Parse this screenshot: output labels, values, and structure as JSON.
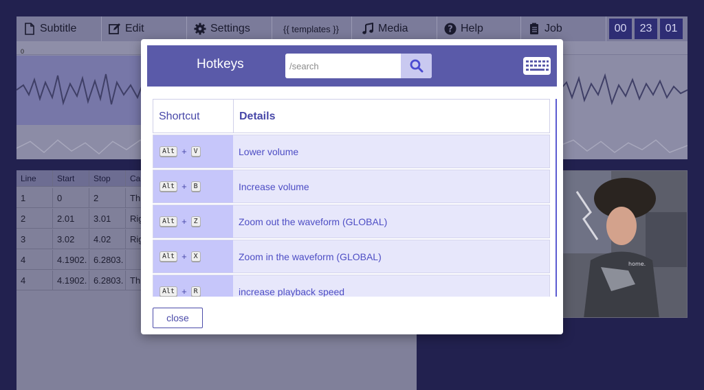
{
  "toolbar": {
    "items": [
      {
        "label": "Subtitle",
        "icon": "file-icon"
      },
      {
        "label": "Edit",
        "icon": "edit-icon"
      },
      {
        "label": "Settings",
        "icon": "gear-icon"
      },
      {
        "label": "{{ templates }}",
        "icon": ""
      },
      {
        "label": "Media",
        "icon": "music-icon"
      },
      {
        "label": "Help",
        "icon": "question-circle-icon"
      },
      {
        "label": "Job",
        "icon": "clipboard-icon"
      }
    ],
    "timer": [
      "00",
      "23",
      "01"
    ]
  },
  "waveform": {
    "zero_label": "0"
  },
  "subtitle_table": {
    "headers": [
      "Line",
      "Start",
      "Stop",
      "Cap"
    ],
    "rows": [
      [
        "1",
        "0",
        "2",
        "Thi"
      ],
      [
        "2",
        "2.01",
        "3.01",
        "Rig"
      ],
      [
        "3",
        "3.02",
        "4.02",
        "Rig"
      ],
      [
        "4",
        "4.1902.",
        "6.2803.",
        ""
      ],
      [
        "4",
        "4.1902.",
        "6.2803.",
        "Thi"
      ]
    ]
  },
  "modal": {
    "title": "Hotkeys",
    "search_placeholder": "/search",
    "columns": {
      "shortcut": "Shortcut",
      "details": "Details"
    },
    "hotkeys": [
      {
        "modifier": "Alt",
        "plus": "+",
        "key": "V",
        "description": "Lower volume"
      },
      {
        "modifier": "Alt",
        "plus": "+",
        "key": "B",
        "description": "Increase volume"
      },
      {
        "modifier": "Alt",
        "plus": "+",
        "key": "Z",
        "description": "Zoom out the waveform (GLOBAL)"
      },
      {
        "modifier": "Alt",
        "plus": "+",
        "key": "X",
        "description": "Zoom in the waveform (GLOBAL)"
      },
      {
        "modifier": "Alt",
        "plus": "+",
        "key": "R",
        "description": "increase playback speed"
      }
    ],
    "close_label": "close"
  },
  "video": {
    "shirt_text": "home."
  },
  "colors": {
    "background": "#22214f",
    "modal_header": "#5a5aa9",
    "accent_text": "#4d4dc4",
    "key_cell": "#c6c6fa",
    "row_bg": "#e7e7fb"
  }
}
